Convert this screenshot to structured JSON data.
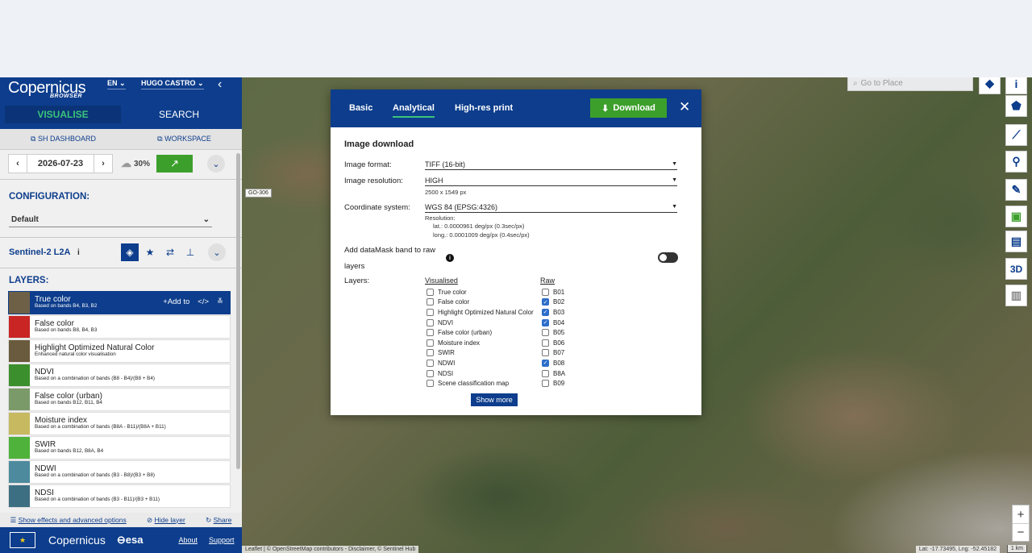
{
  "sidebar": {
    "logo": "opernicus",
    "logo_sub": "BROWSER",
    "language": "EN",
    "user": "HUGO CASTRO",
    "tabs": {
      "visualise": "VISUALISE",
      "search": "SEARCH"
    },
    "links": {
      "dashboard": "SH DASHBOARD",
      "workspace": "WORKSPACE"
    },
    "date": "2026-07-23",
    "cloud_coverage": "30%",
    "configuration_title": "CONFIGURATION:",
    "configuration_value": "Default",
    "dataset": "Sentinel-2 L2A",
    "layers_title": "LAYERS:",
    "add_to_label": "Add to",
    "layers": [
      {
        "title": "True color",
        "desc": "Based on bands B4, B3, B2",
        "color": "#6d6046",
        "active": true
      },
      {
        "title": "False color",
        "desc": "Based on bands B8, B4, B3",
        "color": "#c92525"
      },
      {
        "title": "Highlight Optimized Natural Color",
        "desc": "Enhanced natural color visualisation",
        "color": "#6b5b3e"
      },
      {
        "title": "NDVI",
        "desc": "Based on a combination of bands (B8 - B4)/(B8 + B4)",
        "color": "#3c8f2d"
      },
      {
        "title": "False color (urban)",
        "desc": "Based on bands B12, B11, B4",
        "color": "#7b9a6a"
      },
      {
        "title": "Moisture index",
        "desc": "Based on a combination of bands (B8A - B11)/(B8A + B11)",
        "color": "#c7b95f"
      },
      {
        "title": "SWIR",
        "desc": "Based on bands B12, B8A, B4",
        "color": "#4fb23a"
      },
      {
        "title": "NDWI",
        "desc": "Based on a combination of bands (B3 - B8)/(B3 + B8)",
        "color": "#4d8a9e"
      },
      {
        "title": "NDSI",
        "desc": "Based on a combination of bands (B3 - B11)/(B3 + B11)",
        "color": "#3d6f82"
      }
    ],
    "footer_links": {
      "effects": "Show effects and advanced options",
      "hide": "Hide layer",
      "share": "Share"
    },
    "bottom": {
      "copernicus": "opernicus",
      "esa": "esa",
      "about": "About",
      "support": "Support"
    }
  },
  "map": {
    "search_placeholder": "Go to Place",
    "road_label": "GO-306",
    "attribution": "Leaflet | © OpenStreetMap contributors - Disclaimer, © Sentinel Hub",
    "coords": "Lat: -17.73495, Lng: -52.45182",
    "scale": "1 km",
    "zoom_in": "+",
    "zoom_out": "−",
    "tools": [
      "layers-icon",
      "info-icon",
      "pentagon-icon",
      "line-icon",
      "pin-icon",
      "ruler-icon",
      "image-icon",
      "film-icon",
      "3d-icon",
      "chart-icon"
    ],
    "label_3d": "3D"
  },
  "modal": {
    "tabs": [
      "Basic",
      "Analytical",
      "High-res print"
    ],
    "active_tab": "Analytical",
    "download_label": "Download",
    "section_title": "Image download",
    "image_format_label": "Image format:",
    "image_format_value": "TIFF (16-bit)",
    "resolution_label": "Image resolution:",
    "resolution_value": "HIGH",
    "resolution_size": "2500 x 1549 px",
    "crs_label": "Coordinate system:",
    "crs_value": "WGS 84 (EPSG:4326)",
    "res_title": "Resolution:",
    "res_lat": "lat.: 0.0000961 deg/px (0.3sec/px)",
    "res_long": "long.: 0.0001009 deg/px (0.4sec/px)",
    "datamask_label_1": "Add dataMask band to raw",
    "datamask_label_2": "layers",
    "layers_label": "Layers:",
    "visualised_head": "Visualised",
    "raw_head": "Raw",
    "visualised": [
      "True color",
      "False color",
      "Highlight Optimized Natural Color",
      "NDVI",
      "False color (urban)",
      "Moisture index",
      "SWIR",
      "NDWI",
      "NDSI",
      "Scene classification map"
    ],
    "raw": [
      {
        "name": "B01",
        "checked": false
      },
      {
        "name": "B02",
        "checked": true
      },
      {
        "name": "B03",
        "checked": true
      },
      {
        "name": "B04",
        "checked": true
      },
      {
        "name": "B05",
        "checked": false
      },
      {
        "name": "B06",
        "checked": false
      },
      {
        "name": "B07",
        "checked": false
      },
      {
        "name": "B08",
        "checked": true
      },
      {
        "name": "B8A",
        "checked": false
      },
      {
        "name": "B09",
        "checked": false
      }
    ],
    "show_more": "Show more"
  }
}
